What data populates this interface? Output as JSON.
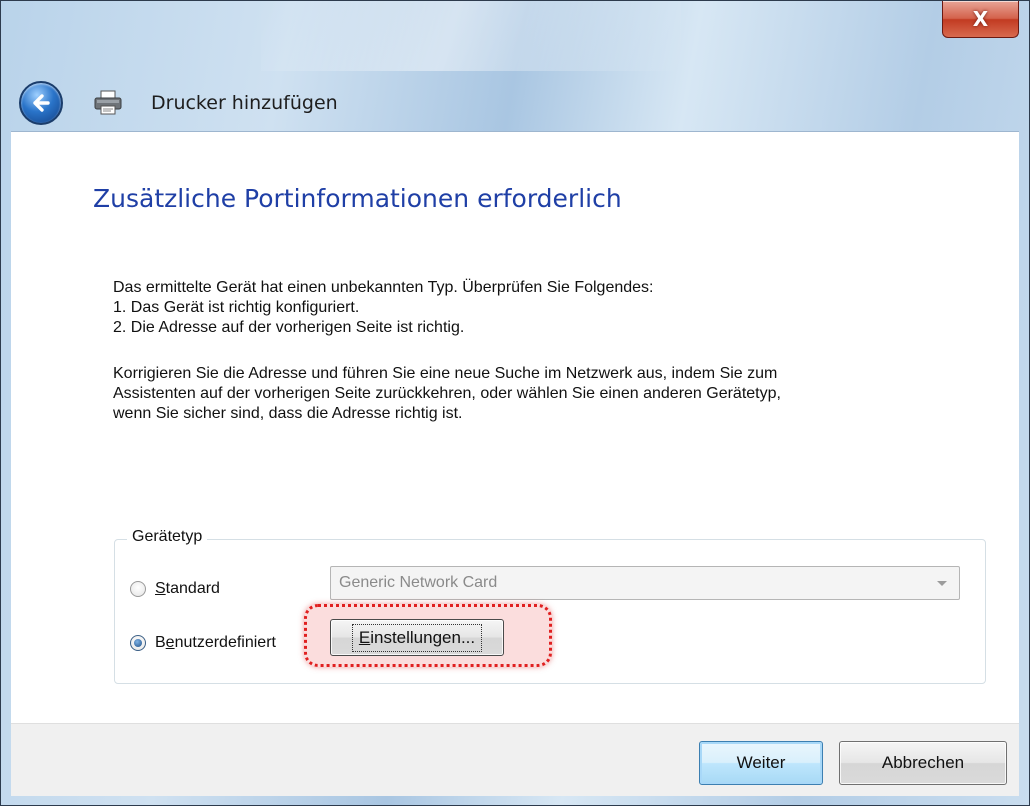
{
  "window": {
    "close_glyph": "X"
  },
  "wizard": {
    "title": "Drucker hinzufügen",
    "heading": "Zusätzliche Portinformationen erforderlich"
  },
  "body": {
    "intro_line": "Das ermittelte Gerät hat einen unbekannten Typ. Überprüfen Sie Folgendes:",
    "check_1": "1. Das Gerät ist richtig konfiguriert.",
    "check_2": "2. Die Adresse auf der vorherigen Seite ist richtig.",
    "para_line_1": "Korrigieren Sie die Adresse und führen Sie eine neue Suche im Netzwerk aus, indem Sie zum",
    "para_line_2": "Assistenten auf der vorherigen Seite zurückkehren, oder wählen Sie einen anderen Gerätetyp,",
    "para_line_3": "wenn Sie sicher sind, dass die Adresse richtig ist."
  },
  "device_type": {
    "legend": "Gerätetyp",
    "standard": {
      "accel": "S",
      "rest": "tandard",
      "checked": false
    },
    "custom": {
      "pre": "B",
      "accel": "e",
      "rest": "nutzerdefiniert",
      "checked": true
    },
    "select_value": "Generic Network Card",
    "settings": {
      "accel": "E",
      "rest": "instellungen..."
    }
  },
  "footer": {
    "next_label": "Weiter",
    "cancel_label": "Abbrechen"
  },
  "colors": {
    "heading": "#1f3fa6",
    "highlight": "#e02020",
    "close": "#c23b22"
  },
  "icons": [
    "back-arrow-icon",
    "printer-icon",
    "close-icon",
    "dropdown-arrow-icon"
  ]
}
